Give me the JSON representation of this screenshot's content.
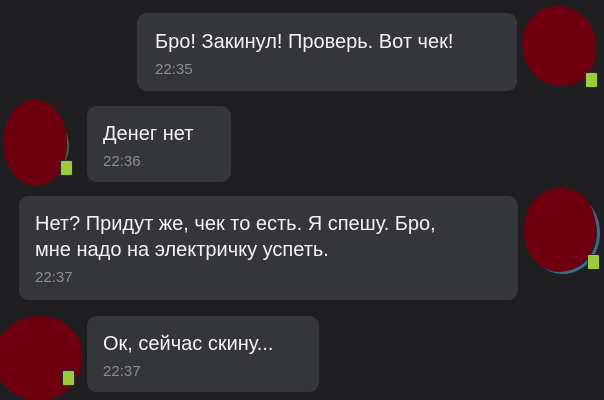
{
  "messages": [
    {
      "text": "Бро! Закинул! Проверь. Вот чек!",
      "time": "22:35",
      "side": "outgoing"
    },
    {
      "text": "Денег нет",
      "time": "22:36",
      "side": "incoming"
    },
    {
      "text": "Нет? Придут же, чек то есть. Я спешу. Бро,\nмне надо на электричку успеть.",
      "time": "22:37",
      "side": "outgoing"
    },
    {
      "text": "Ок, сейчас скину...",
      "time": "22:37",
      "side": "incoming"
    }
  ],
  "colors": {
    "background": "#1f1f21",
    "bubble": "#35363a",
    "text": "#f2f2f2",
    "time": "#8a8c90",
    "avatar_redaction": "#6e0010",
    "badge": "#9acb3c"
  },
  "icons": {
    "avatar": "avatar-redacted-icon",
    "badge": "phone-badge-icon"
  }
}
